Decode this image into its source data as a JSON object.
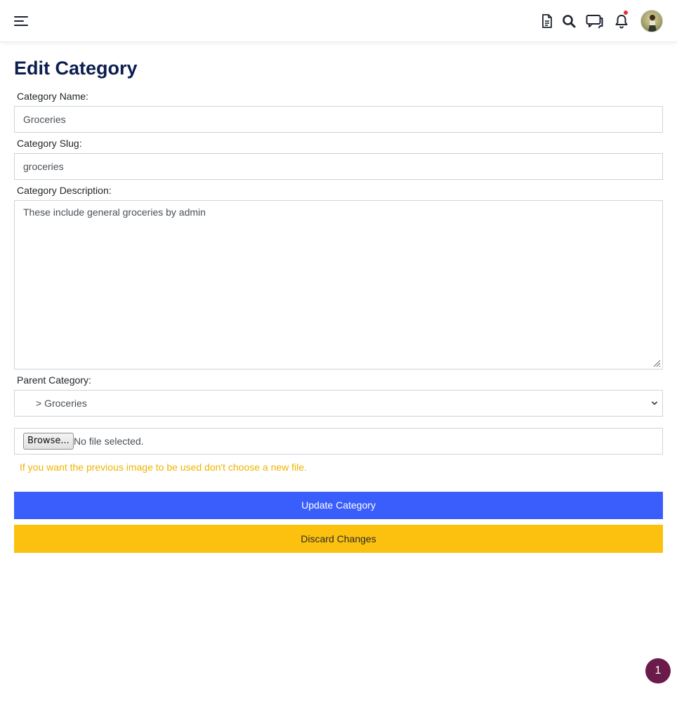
{
  "header": {
    "icons": [
      "menu-icon",
      "document-icon",
      "search-icon",
      "chat-icon",
      "bell-icon",
      "avatar"
    ],
    "has_notification": true
  },
  "page": {
    "title": "Edit Category"
  },
  "form": {
    "name_label": "Category Name:",
    "name_value": "Groceries",
    "slug_label": "Category Slug:",
    "slug_value": "groceries",
    "description_label": "Category Description:",
    "description_value": "These include general groceries by admin",
    "parent_label": "Parent Category:",
    "parent_value": "> Groceries",
    "file_button": "Browse...",
    "file_status": "No file selected.",
    "image_hint": "If you want the previous image to be used don't choose a new file.",
    "update_button": "Update Category",
    "discard_button": "Discard Changes"
  },
  "badge": {
    "count": "1"
  },
  "colors": {
    "title": "#0c1d4f",
    "primary": "#3a5efc",
    "warning": "#fcc10e",
    "hint": "#f0b400",
    "badge": "#6a1b4a",
    "notification_dot": "#e0313a"
  }
}
